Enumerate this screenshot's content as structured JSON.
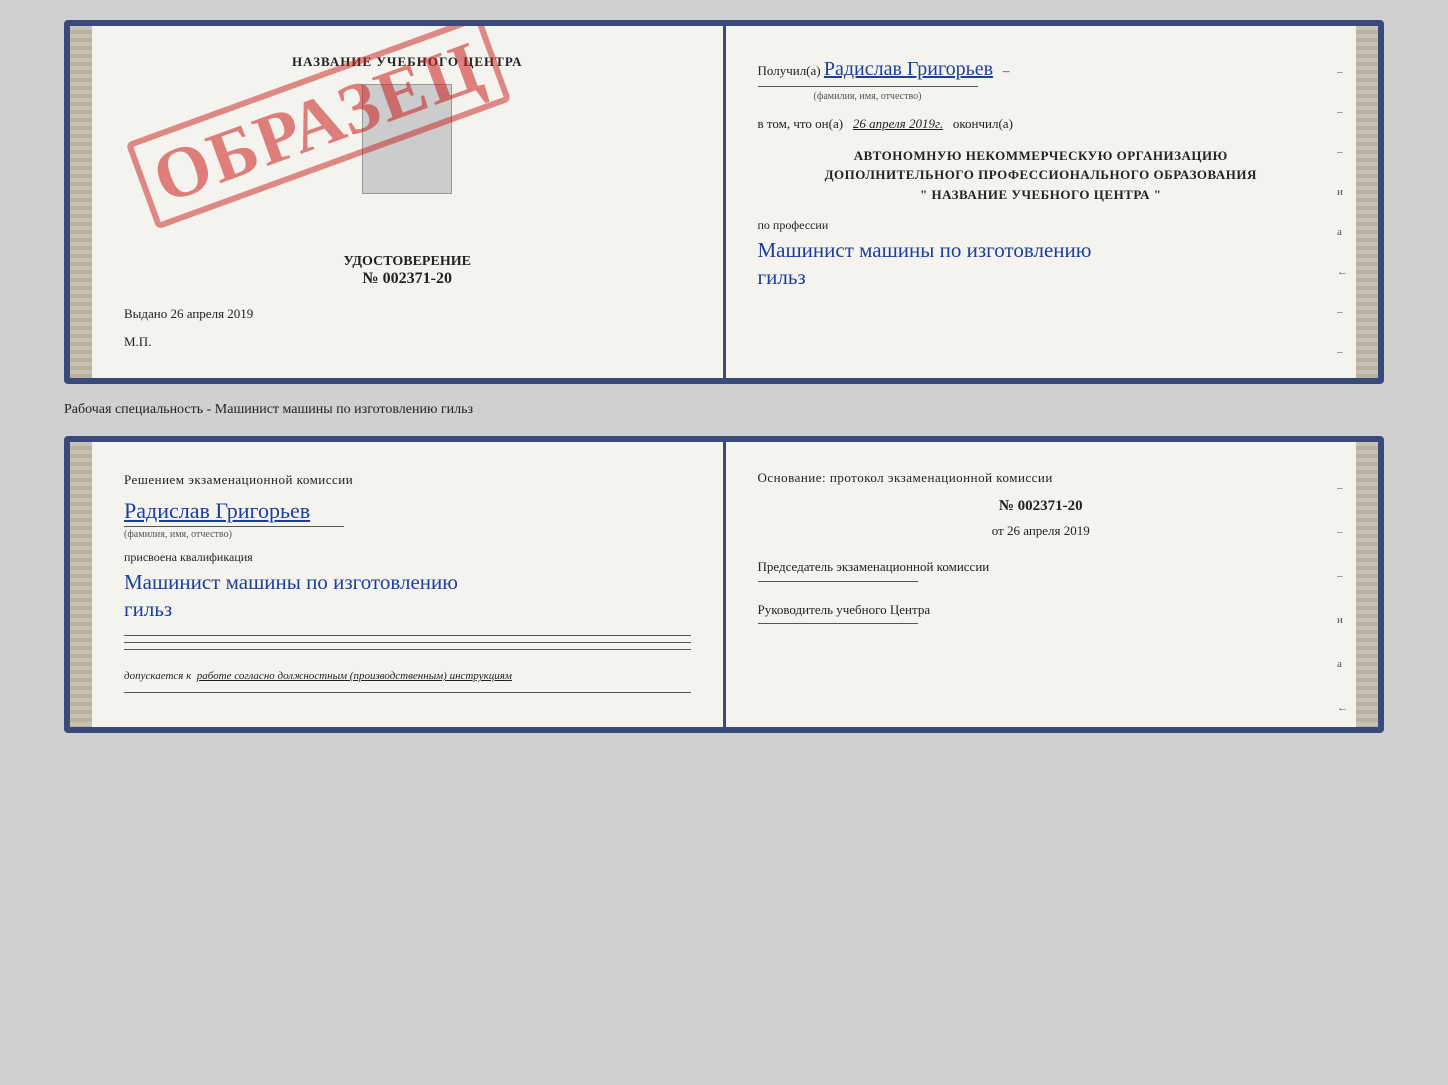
{
  "top_doc": {
    "left": {
      "title": "НАЗВАНИЕ УЧЕБНОГО ЦЕНТРА",
      "stamp": "ОБРАЗЕЦ",
      "cert_label": "УДОСТОВЕРЕНИЕ",
      "cert_number": "№ 002371-20",
      "issued_prefix": "Выдано",
      "issued_date": "26 апреля 2019",
      "mp_label": "М.П."
    },
    "right": {
      "received_prefix": "Получил(а)",
      "fio_handwritten": "Радислав Григорьев",
      "fio_sub": "(фамилия, имя, отчество)",
      "date_prefix": "в том, что он(а)",
      "date_value": "26 апреля 2019г.",
      "date_suffix": "окончил(а)",
      "org_line1": "АВТОНОМНУЮ НЕКОММЕРЧЕСКУЮ ОРГАНИЗАЦИЮ",
      "org_line2": "ДОПОЛНИТЕЛЬНОГО ПРОФЕССИОНАЛЬНОГО ОБРАЗОВАНИЯ",
      "org_quote": "\" НАЗВАНИЕ УЧЕБНОГО ЦЕНТРА \"",
      "prof_label": "по профессии",
      "prof_value1": "Машинист машины по изготовлению",
      "prof_value2": "гильз",
      "side_marks": [
        "–",
        "–",
        "–",
        "и",
        "а",
        "←",
        "–",
        "–",
        "–"
      ]
    }
  },
  "separator": "Рабочая специальность - Машинист машины по изготовлению гильз",
  "bottom_doc": {
    "left": {
      "title": "Решением  экзаменационной  комиссии",
      "fio_handwritten": "Радислав Григорьев",
      "fio_sub": "(фамилия, имя, отчество)",
      "assigned_label": "присвоена квалификация",
      "assigned_value1": "Машинист  машины  по  изготовлению",
      "assigned_value2": "гильз",
      "allowed_prefix": "допускается к",
      "allowed_underline": "работе согласно должностным (производственным) инструкциям"
    },
    "right": {
      "osnov_title": "Основание:  протокол  экзаменационной  комиссии",
      "protocol_number": "№  002371-20",
      "protocol_date_prefix": "от",
      "protocol_date_value": "26 апреля 2019",
      "chairman_label": "Председатель экзаменационной комиссии",
      "head_label": "Руководитель учебного Центра",
      "side_marks": [
        "–",
        "–",
        "–",
        "и",
        "а",
        "←",
        "–",
        "–",
        "–"
      ]
    }
  }
}
